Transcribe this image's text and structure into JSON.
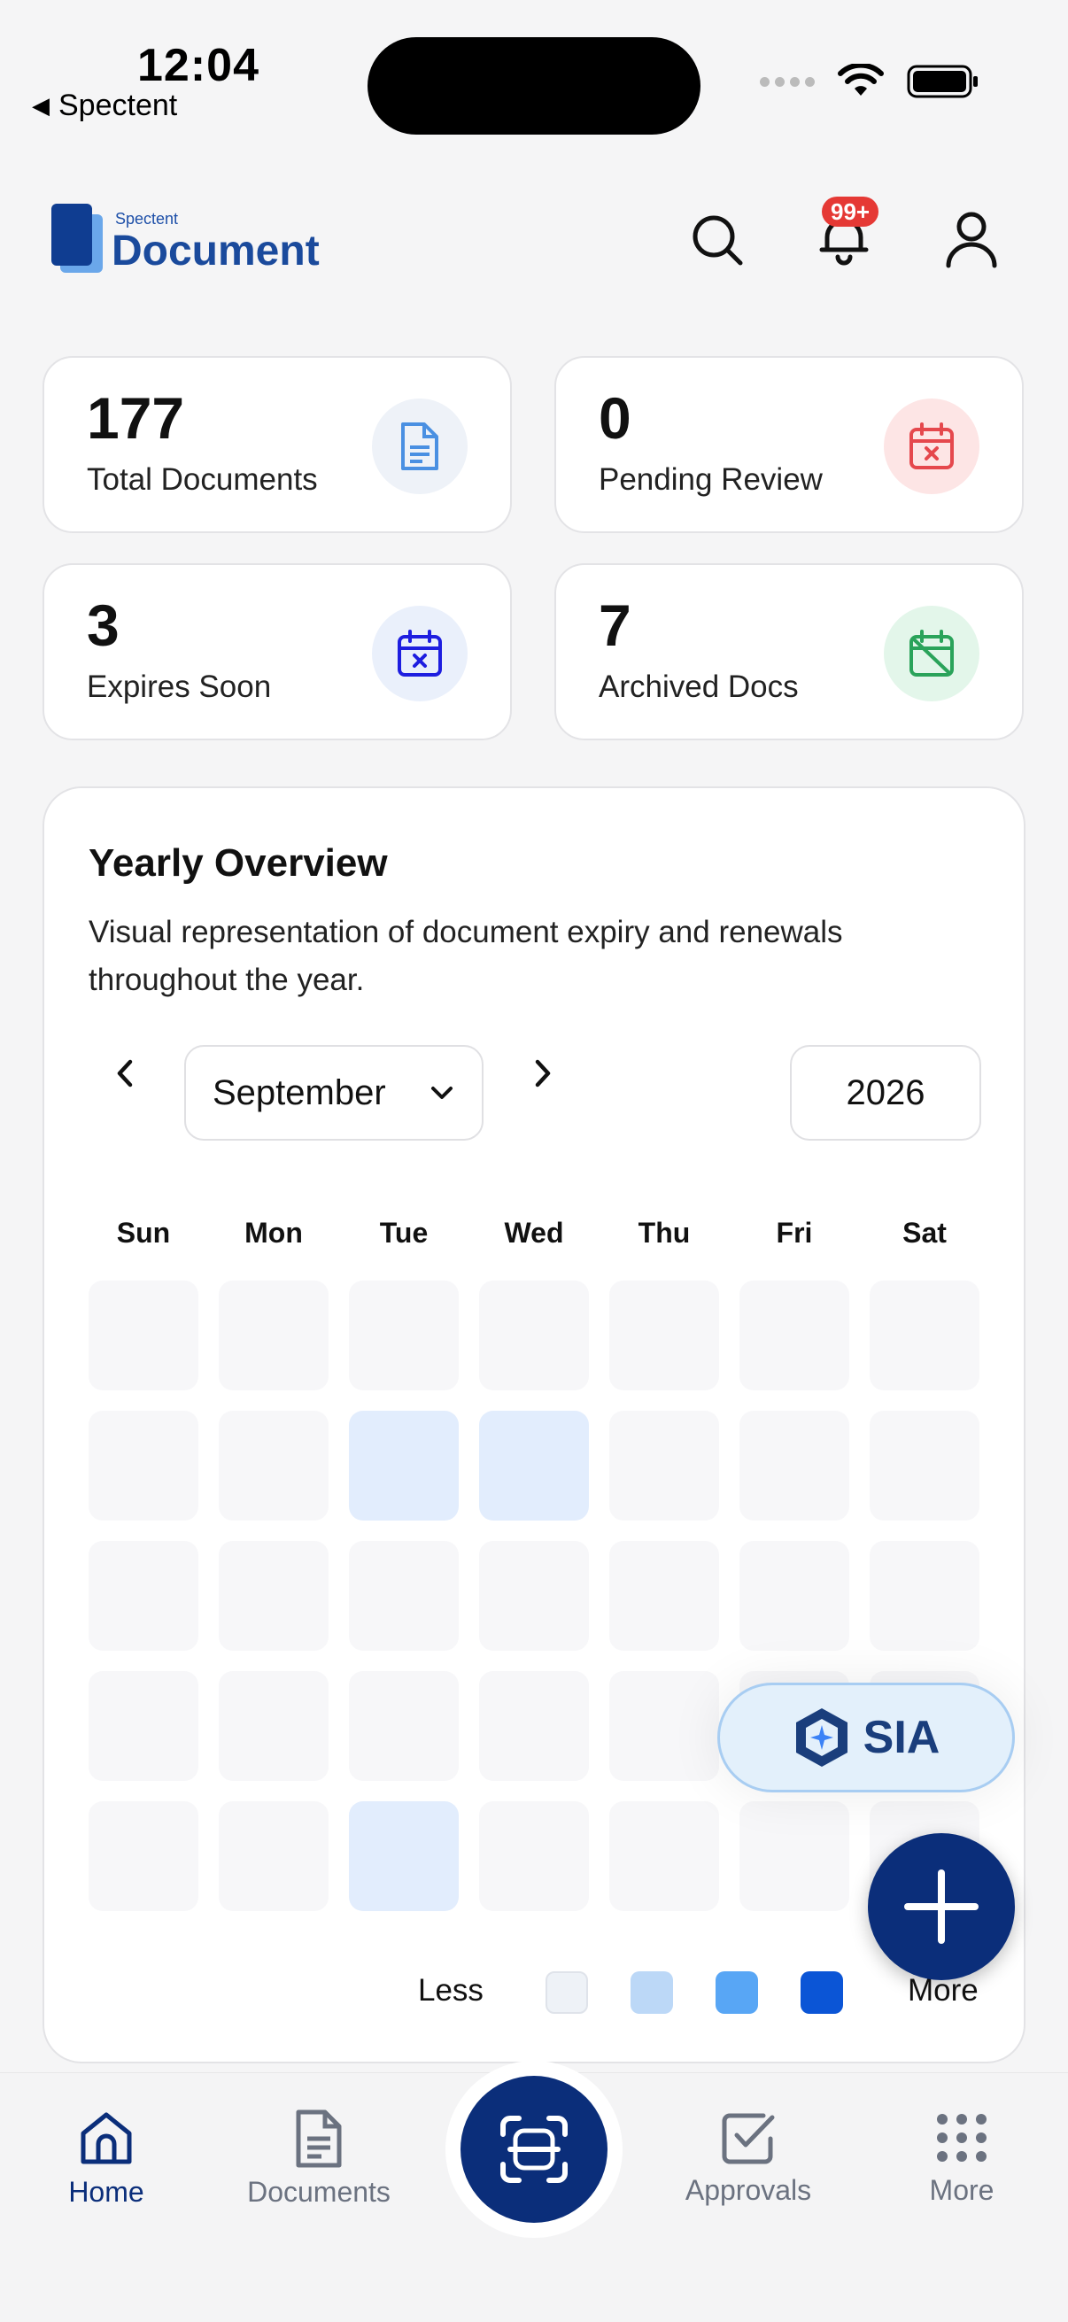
{
  "status_bar": {
    "time": "12:04",
    "back_app": "Spectent"
  },
  "header": {
    "logo_sub": "Spectent",
    "logo_main": "Document",
    "notification_badge": "99+"
  },
  "stats": [
    {
      "value": "177",
      "label": "Total Documents",
      "icon": "document-icon",
      "icon_bg": "#eef2f8",
      "icon_color": "#4a90e2"
    },
    {
      "value": "0",
      "label": "Pending Review",
      "icon": "calendar-x-icon",
      "icon_bg": "#fde5e5",
      "icon_color": "#e5484d"
    },
    {
      "value": "3",
      "label": "Expires Soon",
      "icon": "calendar-x-icon",
      "icon_bg": "#eaf0fb",
      "icon_color": "#1e1ee0"
    },
    {
      "value": "7",
      "label": "Archived Docs",
      "icon": "calendar-off-icon",
      "icon_bg": "#e3f6ea",
      "icon_color": "#2aa35a"
    }
  ],
  "overview": {
    "title": "Yearly Overview",
    "description": "Visual representation of document expiry and renewals throughout the year.",
    "month": "September",
    "year": "2026",
    "weekdays": [
      "Sun",
      "Mon",
      "Tue",
      "Wed",
      "Thu",
      "Fri",
      "Sat"
    ],
    "heat_levels": [
      [
        0,
        0,
        0,
        0,
        0,
        0,
        0
      ],
      [
        0,
        0,
        1,
        1,
        0,
        0,
        0
      ],
      [
        0,
        0,
        0,
        0,
        0,
        0,
        0
      ],
      [
        0,
        0,
        0,
        0,
        0,
        0,
        0
      ],
      [
        0,
        0,
        1,
        0,
        0,
        0,
        0
      ]
    ],
    "legend_less": "Less",
    "legend_more": "More",
    "legend_colors": [
      "#eef2f7",
      "#bcd8f7",
      "#58a6f5",
      "#0b55d6"
    ]
  },
  "sia_label": "SIA",
  "bottom_nav": {
    "items": [
      {
        "label": "Home",
        "active": true
      },
      {
        "label": "Documents",
        "active": false
      },
      {
        "label": "Approvals",
        "active": false
      },
      {
        "label": "More",
        "active": false
      }
    ]
  },
  "colors": {
    "primary": "#0b2e7a",
    "accent": "#1a4a9c"
  }
}
